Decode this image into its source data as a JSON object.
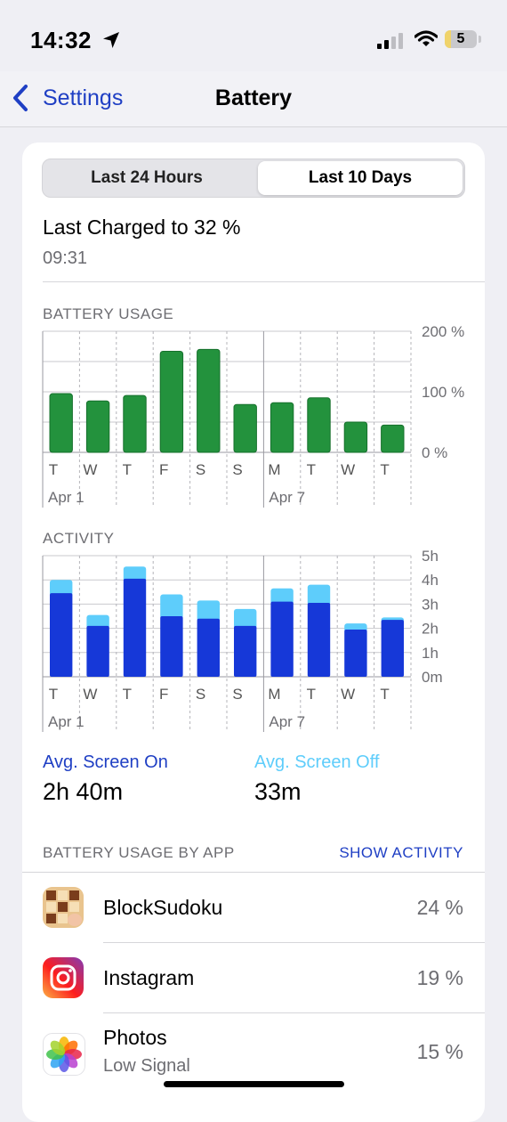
{
  "status_bar": {
    "time": "14:32",
    "battery_level": "5"
  },
  "nav": {
    "back_label": "Settings",
    "title": "Battery"
  },
  "segmented": {
    "left": "Last 24 Hours",
    "right": "Last 10 Days",
    "selected": "Last 10 Days"
  },
  "last_charged": {
    "title": "Last Charged to 32 %",
    "time": "09:31"
  },
  "battery_usage": {
    "label": "BATTERY USAGE"
  },
  "activity": {
    "label": "ACTIVITY"
  },
  "averages": {
    "screen_on_label": "Avg. Screen On",
    "screen_on_value": "2h 40m",
    "screen_off_label": "Avg. Screen Off",
    "screen_off_value": "33m"
  },
  "apps_section": {
    "header": "BATTERY USAGE BY APP",
    "action": "SHOW ACTIVITY"
  },
  "apps": [
    {
      "name": "BlockSudoku",
      "subtitle": "",
      "percent": "24 %"
    },
    {
      "name": "Instagram",
      "subtitle": "",
      "percent": "19 %"
    },
    {
      "name": "Photos",
      "subtitle": "Low Signal",
      "percent": "15 %"
    }
  ],
  "colors": {
    "accent": "#1f3fc4",
    "battery_bar": "#23923d",
    "screen_on": "#1638d8",
    "screen_off": "#5ecdfb"
  },
  "chart_data": [
    {
      "type": "bar",
      "title": "BATTERY USAGE",
      "categories": [
        "T",
        "W",
        "T",
        "F",
        "S",
        "S",
        "M",
        "T",
        "W",
        "T"
      ],
      "date_labels": [
        "Apr 1",
        "Apr 7"
      ],
      "values": [
        97,
        85,
        94,
        167,
        170,
        79,
        82,
        90,
        50,
        45
      ],
      "yticks": [
        "200 %",
        "100 %",
        "0 %"
      ],
      "ylim": [
        0,
        200
      ],
      "unit": "%"
    },
    {
      "type": "bar",
      "stacked": true,
      "title": "ACTIVITY",
      "categories": [
        "T",
        "W",
        "T",
        "F",
        "S",
        "S",
        "M",
        "T",
        "W",
        "T"
      ],
      "date_labels": [
        "Apr 1",
        "Apr 7"
      ],
      "series": [
        {
          "name": "Avg. Screen On",
          "values": [
            3.45,
            2.1,
            4.05,
            2.5,
            2.4,
            2.1,
            3.1,
            3.05,
            1.95,
            2.35
          ]
        },
        {
          "name": "Avg. Screen Off",
          "values": [
            0.55,
            0.45,
            0.5,
            0.9,
            0.75,
            0.7,
            0.55,
            0.75,
            0.25,
            0.1
          ]
        }
      ],
      "yticks": [
        "5h",
        "4h",
        "3h",
        "2h",
        "1h",
        "0m"
      ],
      "ylim": [
        0,
        5
      ],
      "unit": "h"
    }
  ]
}
